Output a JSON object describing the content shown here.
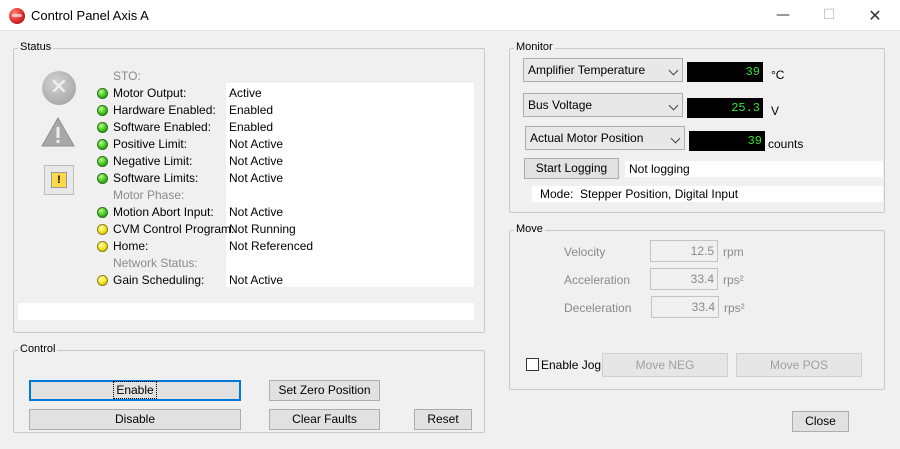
{
  "window": {
    "title": "Control Panel Axis A",
    "min_label": "—",
    "max_label": "☐",
    "close_label": "✕"
  },
  "status": {
    "group_label": "Status",
    "rows": [
      {
        "label": "STO:",
        "value": "",
        "led": "none",
        "dim": true
      },
      {
        "label": "Motor Output:",
        "value": "Active",
        "led": "green",
        "dim": false
      },
      {
        "label": "Hardware Enabled:",
        "value": "Enabled",
        "led": "green",
        "dim": false
      },
      {
        "label": "Software Enabled:",
        "value": "Enabled",
        "led": "green",
        "dim": false
      },
      {
        "label": "Positive Limit:",
        "value": "Not Active",
        "led": "green",
        "dim": false
      },
      {
        "label": "Negative Limit:",
        "value": "Not Active",
        "led": "green",
        "dim": false
      },
      {
        "label": "Software Limits:",
        "value": "Not Active",
        "led": "green",
        "dim": false
      },
      {
        "label": "Motor Phase:",
        "value": "",
        "led": "none",
        "dim": true
      },
      {
        "label": "Motion Abort Input:",
        "value": "Not Active",
        "led": "green",
        "dim": false
      },
      {
        "label": "CVM Control Program:",
        "value": "Not Running",
        "led": "yellow",
        "dim": false
      },
      {
        "label": "Home:",
        "value": "Not Referenced",
        "led": "yellow",
        "dim": false
      },
      {
        "label": "Network Status:",
        "value": "",
        "led": "none",
        "dim": true
      },
      {
        "label": "Gain Scheduling:",
        "value": "Not Active",
        "led": "yellow",
        "dim": false
      }
    ],
    "fault_icon_glyph": "✕",
    "warning_icon_glyph": "!",
    "small_warning_glyph": "!"
  },
  "control": {
    "group_label": "Control",
    "enable_label": "Enable",
    "disable_label": "Disable",
    "set_zero_label": "Set Zero Position",
    "clear_faults_label": "Clear Faults",
    "reset_label": "Reset"
  },
  "monitor": {
    "group_label": "Monitor",
    "channels": [
      {
        "selected": "Amplifier Temperature",
        "value": "39",
        "unit": "°C"
      },
      {
        "selected": "Bus Voltage",
        "value": "25.3",
        "unit": "V"
      },
      {
        "selected": "Actual Motor Position",
        "value": "39",
        "unit": "counts"
      }
    ],
    "start_logging_label": "Start Logging",
    "logging_status": "Not logging",
    "mode_label": "Mode:",
    "mode_value": "Stepper Position, Digital Input"
  },
  "move": {
    "group_label": "Move",
    "velocity_label": "Velocity",
    "velocity_value": "12.5",
    "velocity_unit": "rpm",
    "acceleration_label": "Acceleration",
    "acceleration_value": "33.4",
    "acceleration_unit": "rps²",
    "deceleration_label": "Deceleration",
    "deceleration_value": "33.4",
    "deceleration_unit": "rps²",
    "enable_jog_label": "Enable Jog",
    "move_neg_label": "Move NEG",
    "move_pos_label": "Move POS"
  },
  "footer": {
    "close_label": "Close"
  },
  "colors": {
    "led_green": "#3cc41a",
    "led_yellow": "#f3e21c",
    "readout_text": "#37e22f",
    "focus_border": "#0078d7"
  }
}
